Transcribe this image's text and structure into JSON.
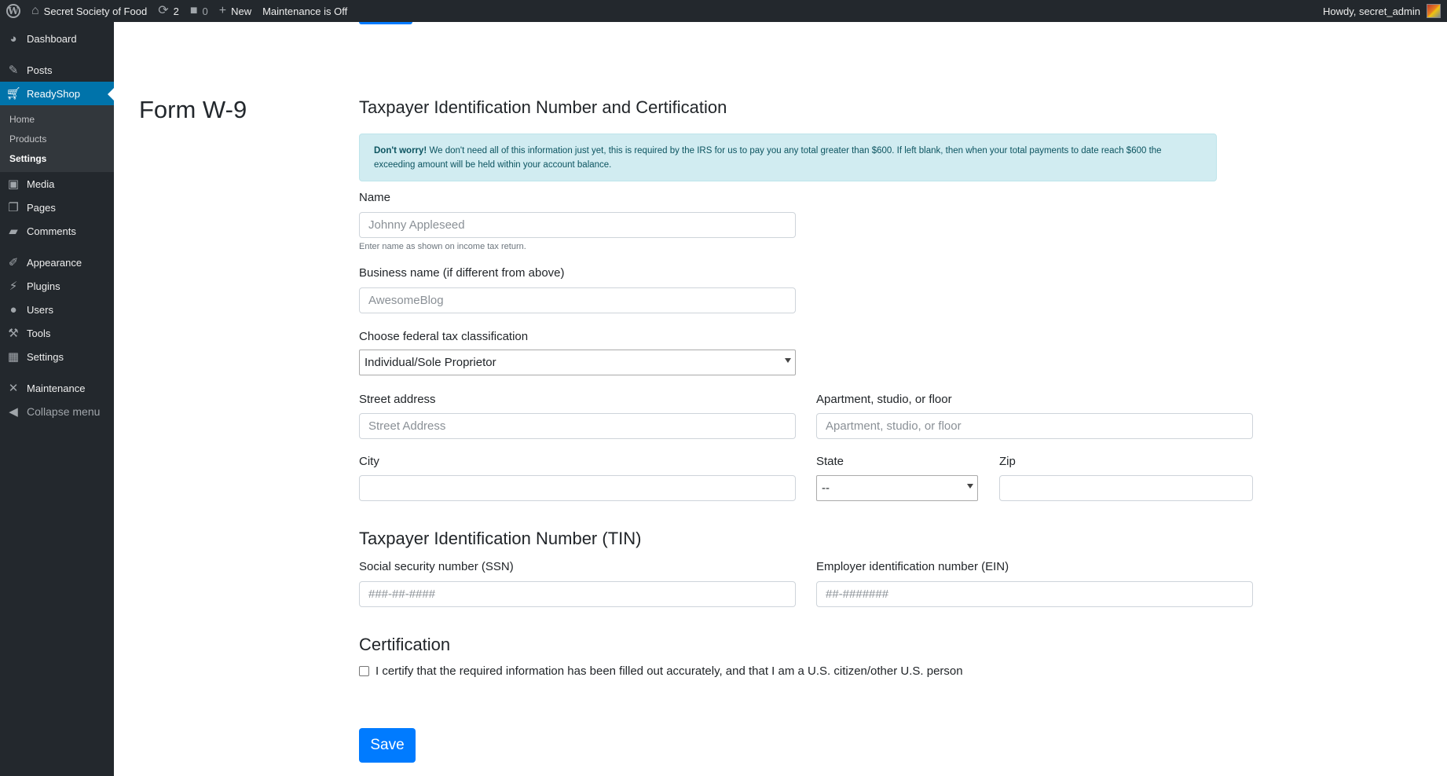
{
  "adminbar": {
    "site_name": "Secret Society of Food",
    "updates_count": "2",
    "comments_count": "0",
    "new_label": "New",
    "maintenance_label": "Maintenance is Off",
    "howdy": "Howdy, secret_admin"
  },
  "sidebar": {
    "items": [
      {
        "label": "Dashboard",
        "icon": "dashboard-icon"
      },
      {
        "label": "Posts",
        "icon": "pushpin-icon"
      },
      {
        "label": "ReadyShop",
        "icon": "cart-icon",
        "current": true
      },
      {
        "label": "Media",
        "icon": "media-icon"
      },
      {
        "label": "Pages",
        "icon": "pages-icon"
      },
      {
        "label": "Comments",
        "icon": "comment-icon"
      },
      {
        "label": "Appearance",
        "icon": "brush-icon"
      },
      {
        "label": "Plugins",
        "icon": "plug-icon"
      },
      {
        "label": "Users",
        "icon": "user-icon"
      },
      {
        "label": "Tools",
        "icon": "wrench-icon"
      },
      {
        "label": "Settings",
        "icon": "settings-icon"
      },
      {
        "label": "Maintenance",
        "icon": "tools-cross-icon"
      },
      {
        "label": "Collapse menu",
        "icon": "collapse-icon"
      }
    ],
    "submenu": [
      {
        "label": "Home"
      },
      {
        "label": "Products"
      },
      {
        "label": "Settings",
        "active": true
      }
    ]
  },
  "page": {
    "title": "Form W-9"
  },
  "form": {
    "section_title": "Taxpayer Identification Number and Certification",
    "alert_strong": "Don't worry!",
    "alert_text": " We don't need all of this information just yet, this is required by the IRS for us to pay you any total greater than $600. If left blank, then when your total payments to date reach $600 the exceeding amount will be held within your account balance.",
    "name_label": "Name",
    "name_placeholder": "Johnny Appleseed",
    "name_help": "Enter name as shown on income tax return.",
    "business_label": "Business name (if different from above)",
    "business_placeholder": "AwesomeBlog",
    "classification_label": "Choose federal tax classification",
    "classification_value": "Individual/Sole Proprietor",
    "street_label": "Street address",
    "street_placeholder": "Street Address",
    "apt_label": "Apartment, studio, or floor",
    "apt_placeholder": "Apartment, studio, or floor",
    "city_label": "City",
    "city_value": "",
    "state_label": "State",
    "state_value": "--",
    "zip_label": "Zip",
    "zip_value": "",
    "tin_heading": "Taxpayer Identification Number (TIN)",
    "ssn_label": "Social security number (SSN)",
    "ssn_placeholder": "###-##-####",
    "ein_label": "Employer identification number (EIN)",
    "ein_placeholder": "##-#######",
    "cert_heading": "Certification",
    "cert_label": "I certify that the required information has been filled out accurately, and that I am a U.S. citizen/other U.S. person",
    "cert_checked": false,
    "save_label": "Save"
  },
  "colors": {
    "adminbar_bg": "#23282d",
    "sidebar_current": "#0073aa",
    "alert_bg": "#d1ecf1",
    "primary_button": "#007bff"
  }
}
